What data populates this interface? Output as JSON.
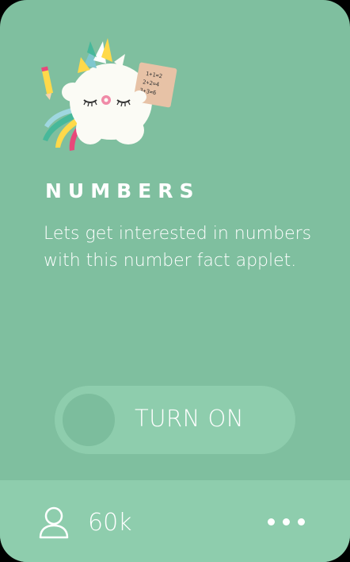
{
  "card": {
    "title": "NUMBERS",
    "description": "Lets get interested in numbers with this number fact applet.",
    "illustration_board_lines": [
      "1+1=2",
      "2+2=4",
      "3+3=6"
    ],
    "toggle_label": "TURN ON",
    "users_count": "60k",
    "colors": {
      "card_bg": "#7fbf9f",
      "footer_bg": "#8ecdad",
      "toggle_bg": "#8ecdad",
      "knob": "#7cbd9d",
      "text": "#ffffff"
    },
    "icons": [
      "unicorn-illustration",
      "user-icon",
      "more-icon"
    ]
  }
}
